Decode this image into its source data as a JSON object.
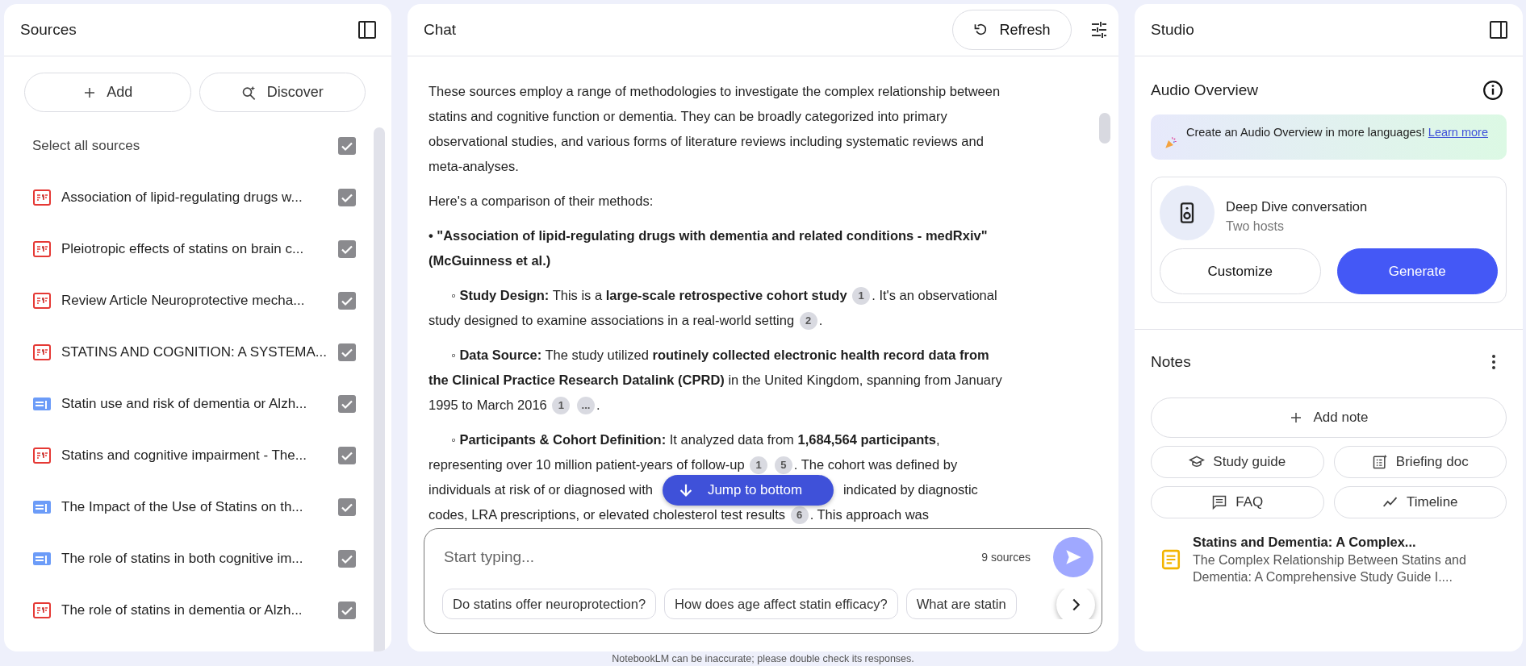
{
  "sources": {
    "title": "Sources",
    "add_button": "Add",
    "discover_button": "Discover",
    "select_all": {
      "label": "Select all sources",
      "checked": true
    },
    "items": [
      {
        "kind": "pdf",
        "title": "Association of lipid-regulating drugs w...",
        "checked": true
      },
      {
        "kind": "pdf",
        "title": "Pleiotropic effects of statins on brain c...",
        "checked": true
      },
      {
        "kind": "pdf",
        "title": "Review Article Neuroprotective mecha...",
        "checked": true
      },
      {
        "kind": "pdf",
        "title": "STATINS AND COGNITION: A SYSTEMA...",
        "checked": true
      },
      {
        "kind": "web",
        "title": "Statin use and risk of dementia or Alzh...",
        "checked": true
      },
      {
        "kind": "pdf",
        "title": "Statins and cognitive impairment - The...",
        "checked": true
      },
      {
        "kind": "web",
        "title": "The Impact of the Use of Statins on th...",
        "checked": true
      },
      {
        "kind": "web",
        "title": "The role of statins in both cognitive im...",
        "checked": true
      },
      {
        "kind": "pdf",
        "title": "The role of statins in dementia or Alzh...",
        "checked": true
      }
    ]
  },
  "chat": {
    "title": "Chat",
    "refresh_button": "Refresh",
    "jump_button": "Jump to bottom",
    "paragraphs": [
      {
        "kind": "plain",
        "segments": [
          {
            "kind": "text",
            "text": "These sources employ a range of methodologies to investigate the complex relationship between statins and cognitive function or dementia. They can be broadly categorized into primary observational studies, and various forms of literature reviews including systematic reviews and meta-analyses."
          }
        ]
      },
      {
        "kind": "plain",
        "segments": [
          {
            "kind": "text",
            "text": "Here's a comparison of their methods:"
          }
        ]
      },
      {
        "kind": "heading",
        "segments": [
          {
            "kind": "text",
            "text": "• \"Association of lipid-regulating drugs with dementia and related conditions - medRxiv\" (McGuinness et al.)"
          }
        ]
      },
      {
        "kind": "sub",
        "segments": [
          {
            "kind": "text",
            "text": "◦ **Study Design:** This is a **large-scale retrospective cohort study**"
          },
          {
            "kind": "cite",
            "label": "1"
          },
          {
            "kind": "text",
            "text": ". It's an observational study designed to examine associations in a real-world setting"
          },
          {
            "kind": "cite",
            "label": "2"
          },
          {
            "kind": "text",
            "text": "."
          }
        ]
      },
      {
        "kind": "sub",
        "segments": [
          {
            "kind": "text",
            "text": "◦ **Data Source:** The study utilized **routinely collected electronic health record data from the Clinical Practice Research Datalink (CPRD)** in the United Kingdom, spanning from January 1995 to March 2016"
          },
          {
            "kind": "cite",
            "label": "1"
          },
          {
            "kind": "cite",
            "label": "..."
          },
          {
            "kind": "text",
            "text": "."
          }
        ]
      },
      {
        "kind": "sub",
        "segments": [
          {
            "kind": "text",
            "text": "◦ **Participants & Cohort Definition:** It analyzed data from **1,684,564 participants**, representing over 10 million patient-years of follow-up"
          },
          {
            "kind": "cite",
            "label": "1"
          },
          {
            "kind": "cite",
            "label": "5"
          },
          {
            "kind": "text",
            "text": ". The cohort was defined by individuals at risk of or diagnosed with"
          },
          {
            "kind": "covered"
          },
          {
            "kind": "text",
            "text": "indicated by diagnostic codes, LRA prescriptions, or elevated cholesterol test results"
          },
          {
            "kind": "cite",
            "label": "6"
          },
          {
            "kind": "text",
            "text": ". This approach was"
          }
        ]
      }
    ],
    "input": {
      "placeholder": "Start typing...",
      "source_count": "9 sources",
      "send_disabled": true
    },
    "suggestions": [
      "Do statins offer neuroprotection?",
      "How does age affect statin efficacy?",
      "What are statin"
    ]
  },
  "studio": {
    "title": "Studio",
    "audio_title": "Audio Overview",
    "banner": {
      "text": "Create an Audio Overview in more languages! ",
      "link": "Learn more"
    },
    "deep_dive": {
      "title": "Deep Dive conversation",
      "subtitle": "Two hosts",
      "customize_button": "Customize",
      "generate_button": "Generate"
    },
    "notes_title": "Notes",
    "add_note_button": "Add note",
    "note_buttons": [
      {
        "kind": "study",
        "label": "Study guide"
      },
      {
        "kind": "briefing",
        "label": "Briefing doc"
      },
      {
        "kind": "faq",
        "label": "FAQ"
      },
      {
        "kind": "timeline",
        "label": "Timeline"
      }
    ],
    "notes": [
      {
        "title": "Statins and Dementia: A Complex...",
        "preview": "The Complex Relationship Between Statins and Dementia: A Comprehensive Study Guide I...."
      }
    ]
  },
  "footer": "NotebookLM can be inaccurate; please double check its responses."
}
